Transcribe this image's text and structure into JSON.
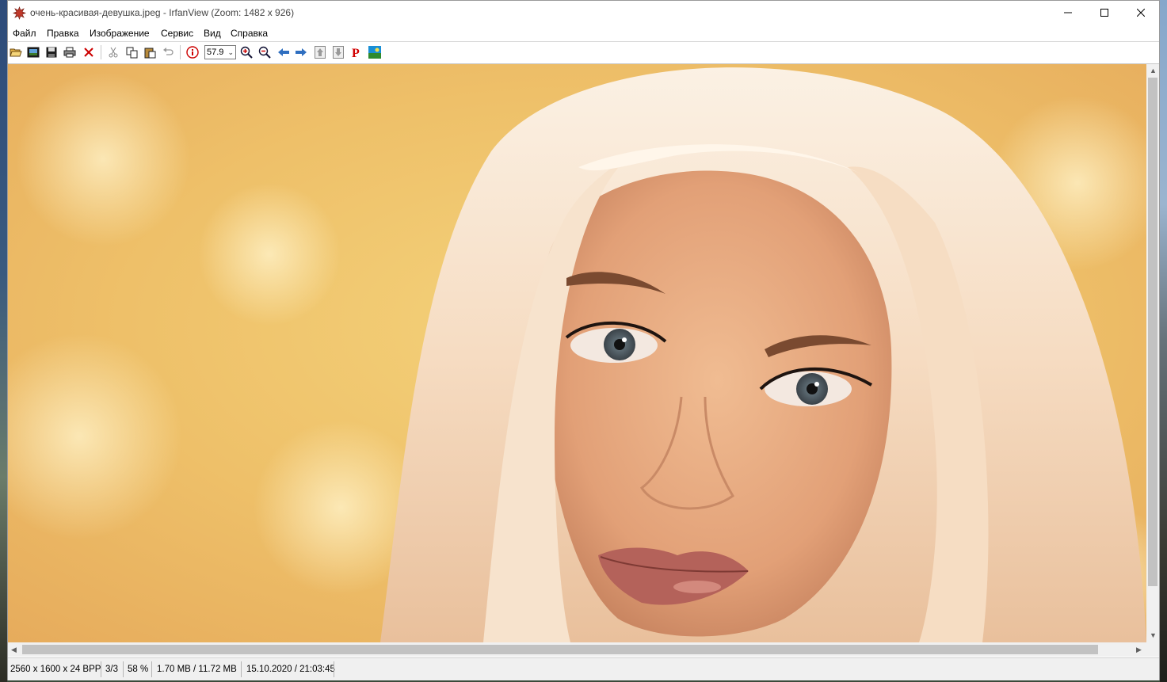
{
  "window": {
    "title": "очень-красивая-девушка.jpeg - IrfanView (Zoom: 1482 x 926)",
    "controls": [
      "minimize",
      "maximize",
      "close"
    ]
  },
  "menu": [
    "Файл",
    "Правка",
    "Изображение",
    "Сервис",
    "Вид",
    "Справка"
  ],
  "toolbar": {
    "buttons": [
      "open-icon",
      "slideshow-icon",
      "save-icon",
      "print-icon",
      "delete-icon",
      "cut-icon",
      "copy-icon",
      "paste-icon",
      "undo-icon",
      "info-icon",
      "zoom-in-icon",
      "zoom-out-icon",
      "previous-icon",
      "next-icon",
      "previous-page-icon",
      "next-page-icon",
      "paint-icon",
      "exit-fullscreen-icon"
    ],
    "zoom_value": "57.9"
  },
  "status": {
    "dimensions": "2560 x 1600 x 24 BPP",
    "index": "3/3",
    "zoom": "58 %",
    "size": "1.70 MB / 11.72 MB",
    "datetime": "15.10.2020 / 21:03:45"
  },
  "colors": {
    "background_warm": "#f3c15a",
    "hair": "#f5dcc0",
    "skin": "#e6a67d"
  }
}
